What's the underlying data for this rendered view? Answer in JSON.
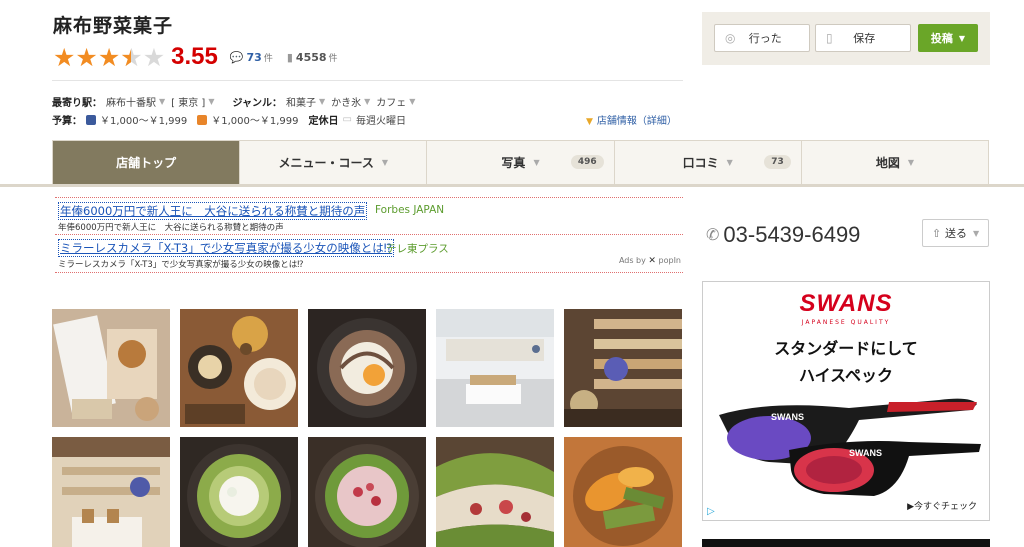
{
  "shop": {
    "name": "麻布野菜菓子",
    "score": "3.55",
    "rating_value": 3.55,
    "rating_max": 5,
    "reviews_count": "73",
    "reviews_unit": "件",
    "saved_count": "4558",
    "saved_unit": "件"
  },
  "info": {
    "station_label": "最寄り駅：",
    "station": "麻布十番駅",
    "area": "[ 東京 ]",
    "genre_label": "ジャンル：",
    "genres": [
      "和菓子",
      "かき氷",
      "カフェ"
    ],
    "budget_label": "予算：",
    "budget_dinner": "￥1,000～￥1,999",
    "budget_lunch": "￥1,000～￥1,999",
    "holiday_label": "定休日",
    "holiday": "毎週火曜日",
    "shopinfo_link": "店舗情報（詳細）"
  },
  "actions": {
    "went_label": "行った",
    "save_label": "保存",
    "post_label": "投稿"
  },
  "tabs": [
    {
      "label": "店舗トップ"
    },
    {
      "label": "メニュー・コース"
    },
    {
      "label": "写真",
      "count": "496"
    },
    {
      "label": "口コミ",
      "count": "73"
    },
    {
      "label": "地図"
    }
  ],
  "ads": [
    {
      "title": "年俸6000万円で新人王に　大谷に送られる称賛と期待の声",
      "source": "Forbes JAPAN",
      "desc": "年俸6000万円で新人王に　大谷に送られる称賛と期待の声"
    },
    {
      "title": "ミラーレスカメラ「X-T3」で少女写真家が撮る少女の映像とは⁉",
      "source": "テレ東プラス",
      "desc": "ミラーレスカメラ「X-T3」で少女写真家が撮る少女の映像とは⁉"
    }
  ],
  "ads_by": "Ads by",
  "ads_provider": "popIn",
  "tel": "03-5439-6499",
  "send_label": "送る",
  "banner": {
    "brand": "SWANS",
    "brand_sub": "JAPANESE QUALITY",
    "copy1": "スタンダードにして",
    "copy2": "ハイスペック",
    "cta": "▶今すぐチェック",
    "lens_text": "SWANS"
  },
  "colors": {
    "star": "#f28c22",
    "score": "#d40000",
    "tab_active": "#827a5f",
    "post_button": "#6aa628",
    "link": "#1a54b8",
    "ad_source": "#5c9c2e",
    "brand_red": "#d5001c"
  }
}
